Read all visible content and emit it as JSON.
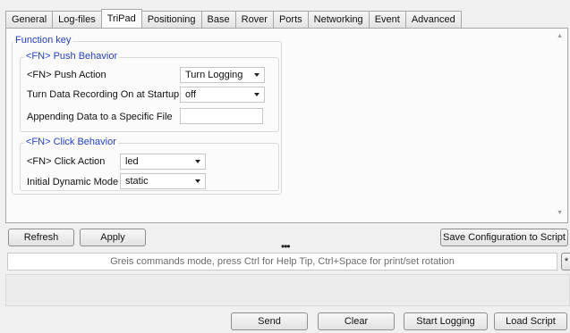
{
  "tabs": [
    {
      "label": "General"
    },
    {
      "label": "Log-files"
    },
    {
      "label": "TriPad",
      "active": true
    },
    {
      "label": "Positioning"
    },
    {
      "label": "Base"
    },
    {
      "label": "Rover"
    },
    {
      "label": "Ports"
    },
    {
      "label": "Networking"
    },
    {
      "label": "Event"
    },
    {
      "label": "Advanced"
    }
  ],
  "function_key": {
    "title": "Function key",
    "push_behavior": {
      "title": "<FN> Push Behavior",
      "push_action_label": "<FN> Push Action",
      "push_action_value": "Turn Logging",
      "startup_label": "Turn Data Recording On at Startup",
      "startup_value": "off",
      "append_label": "Appending Data to a Specific File",
      "append_value": ""
    },
    "click_behavior": {
      "title": "<FN> Click Behavior",
      "click_action_label": "<FN> Click Action",
      "click_action_value": "led",
      "dynamic_mode_label": "Initial Dynamic Mode",
      "dynamic_mode_value": "static"
    }
  },
  "buttons": {
    "refresh": "Refresh",
    "apply": "Apply",
    "save_config": "Save Configuration to Script",
    "send": "Send",
    "clear": "Clear",
    "start_logging": "Start Logging",
    "load_script": "Load Script",
    "side_button": "*"
  },
  "command": {
    "placeholder": "Greis commands mode, press Ctrl for Help Tip, Ctrl+Space for print/set rotation"
  },
  "splitter_glyph": "•••",
  "icons": {
    "scroll_up": "▲",
    "scroll_down": "▼"
  }
}
